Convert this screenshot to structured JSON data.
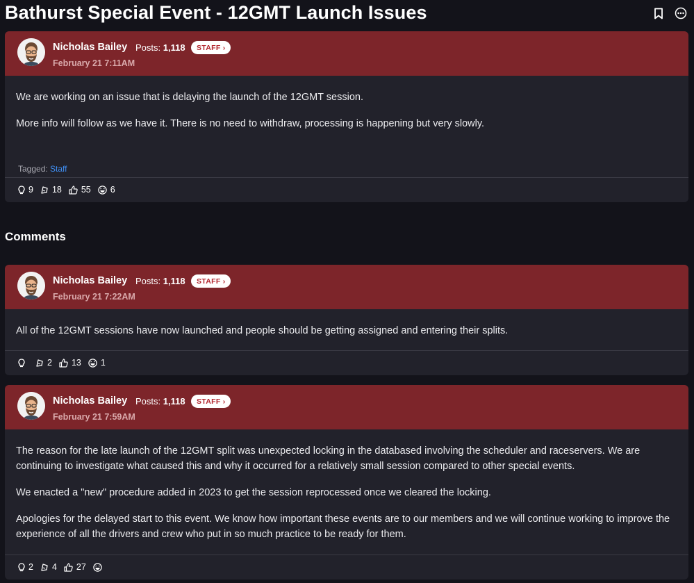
{
  "page": {
    "title": "Bathurst Special Event - 12GMT Launch Issues",
    "bookmark_icon": "bookmark-icon",
    "more_icon": "more-options-icon"
  },
  "colors": {
    "background": "#13131a",
    "header_red": "#7d252a",
    "card": "#22222b",
    "staff_badge_text": "#b3262e",
    "tag_link": "#3f8ef2"
  },
  "original_post": {
    "author": "Nicholas Bailey",
    "posts_label": "Posts:",
    "posts_count": "1,118",
    "badge": "STAFF ›",
    "date": "February 21 7:11AM",
    "paragraphs": [
      "We are working on an issue that is delaying the launch of the 12GMT session.",
      "More info will follow as we have it. There is no need to withdraw, processing is happening but very slowly."
    ],
    "tagged_label": "Tagged:",
    "tag": "Staff",
    "reactions": {
      "insightful": "9",
      "awesome": "18",
      "like": "55",
      "lol": "6"
    }
  },
  "comments_heading": "Comments",
  "comments": [
    {
      "author": "Nicholas Bailey",
      "posts_label": "Posts:",
      "posts_count": "1,118",
      "badge": "STAFF ›",
      "date": "February 21 7:22AM",
      "paragraphs": [
        "All of the 12GMT sessions have now launched and people should be getting assigned and entering their splits."
      ],
      "reactions": {
        "insightful": "",
        "awesome": "2",
        "like": "13",
        "lol": "1"
      }
    },
    {
      "author": "Nicholas Bailey",
      "posts_label": "Posts:",
      "posts_count": "1,118",
      "badge": "STAFF ›",
      "date": "February 21 7:59AM",
      "paragraphs": [
        "The reason for the late launch of the 12GMT split was unexpected locking in the databased involving the scheduler and raceservers. We are continuing to investigate what caused this and why it occurred for a relatively small session compared to other special events.",
        "We enacted a \"new\" procedure added in 2023 to get the session reprocessed once we cleared the locking.",
        "Apologies for the delayed start to this event. We know how important these events are to our members and we will continue working to improve the experience of all the drivers and crew who put in so much practice to be ready for them."
      ],
      "reactions": {
        "insightful": "2",
        "awesome": "4",
        "like": "27",
        "lol": ""
      }
    }
  ]
}
